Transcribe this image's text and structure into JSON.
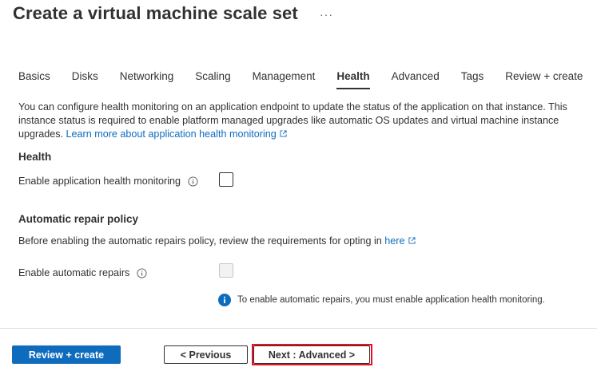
{
  "header": {
    "title": "Create a virtual machine scale set",
    "more_label": "···"
  },
  "tabs": [
    {
      "label": "Basics",
      "active": false
    },
    {
      "label": "Disks",
      "active": false
    },
    {
      "label": "Networking",
      "active": false
    },
    {
      "label": "Scaling",
      "active": false
    },
    {
      "label": "Management",
      "active": false
    },
    {
      "label": "Health",
      "active": true
    },
    {
      "label": "Advanced",
      "active": false
    },
    {
      "label": "Tags",
      "active": false
    },
    {
      "label": "Review + create",
      "active": false
    }
  ],
  "description": {
    "text": "You can configure health monitoring on an application endpoint to update the status of the application on that instance. This instance status is required to enable platform managed upgrades like automatic OS updates and virtual machine instance upgrades. ",
    "link_text": "Learn more about application health monitoring"
  },
  "health": {
    "title": "Health",
    "enable_label": "Enable application health monitoring",
    "enable_checked": false
  },
  "repair": {
    "title": "Automatic repair policy",
    "intro_text": "Before enabling the automatic repairs policy, review the requirements for opting in ",
    "intro_link": "here",
    "enable_label": "Enable automatic repairs",
    "enable_checked": false,
    "enable_disabled": true,
    "info_message": "To enable automatic repairs, you must enable application health monitoring."
  },
  "footer": {
    "review_create": "Review + create",
    "previous": "< Previous",
    "next": "Next : Advanced >"
  },
  "colors": {
    "primary": "#0f6cbd",
    "highlight": "#e81123"
  }
}
